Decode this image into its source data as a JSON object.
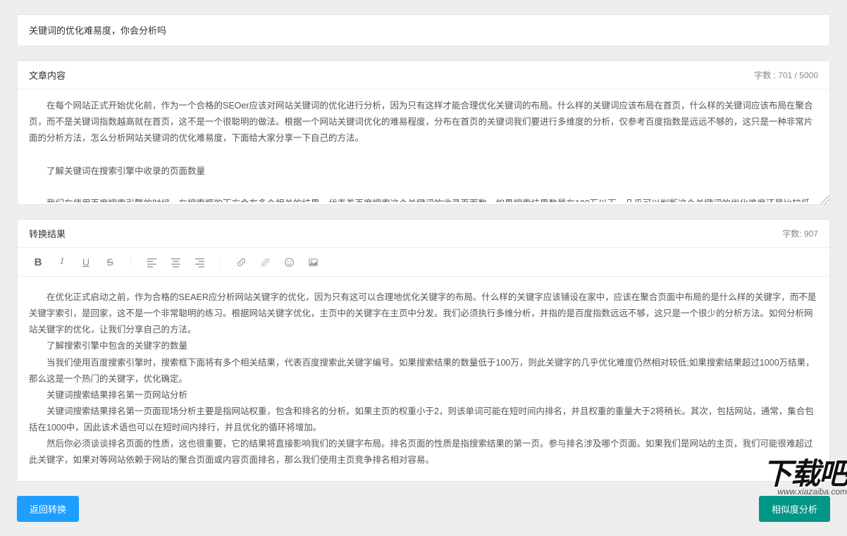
{
  "title_input": {
    "value": "关键词的优化难易度，你会分析吗"
  },
  "content_section": {
    "label": "文章内容",
    "count_label": "字数 : 701 / 5000",
    "textarea_value": "　　在每个网站正式开始优化前，作为一个合格的SEOer应该对网站关键词的优化进行分析，因为只有这样才能合理优化关键词的布局。什么样的关键词应该布局在首页，什么样的关键词应该布局在聚合页，而不是关键词指数越高就在首页，这不是一个很聪明的做法。根据一个网站关键词优化的难易程度，分布在首页的关键词我们要进行多维度的分析，仅参考百度指数是远远不够的，这只是一种非常片面的分析方法，怎么分析网站关键词的优化难易度，下面给大家分享一下自己的方法。\n\n　　了解关键词在搜索引擎中收录的页面数量\n\n　　我们在使用百度搜索引擎的时候，在搜索框的下方会有多个相关的结果，代表着百度搜索这个关键词的收录页面数。如果搜索结果数量在100万以下，几乎可以判断这个关键词的优化难度还是比较低的；如果搜索结果在1000万以上的结果，那么这是一个热门关键词，优化是有一定难度的。\n\n　　关键词搜索结果排名第一页网站分析"
  },
  "result_section": {
    "label": "转换结果",
    "count_label": "字数: 907",
    "paragraphs": [
      "在优化正式启动之前，作为合格的SEAER应分析网站关键字的优化，因为只有这可以合理地优化关键字的布局。什么样的关键字应该铺设在家中，应该在聚合页面中布局的是什么样的关键字，而不是关键字索引，是回家，这不是一个非常聪明的练习。根据网站关键字优化，主页中的关键字在主页中分发。我们必须执行多维分析，并指的是百度指数远远不够，这只是一个很少的分析方法。如何分析网站关键字的优化，让我们分享自己的方法。",
      "了解搜索引擎中包含的关键字的数量",
      "当我们使用百度搜索引擎时，搜索框下面将有多个相关结果，代表百度搜索此关键字编号。如果搜索结果的数量低于100万，则此关键字的几乎优化难度仍然相对较低;如果搜索结果超过1000万结果，那么这是一个热门的关键字，优化确定。",
      "关键词搜索结果排名第一页网站分析",
      "关键词搜索结果排名第一页面现场分析主要是指网站权重，包含和排名的分析。如果主页的权重小于2，则该单词可能在短时间内排名，并且权重的重量大于2将稍长。其次，包括网站，通常，集合包括在1000中，因此该术语也可以在短时间内排行，并且优化的循环将增加。",
      "然后你必须谈谈排名页面的性质，这也很重要，它的结果将直接影响我们的关键字布局。排名页面的性质是指搜索结果的第一页。参与排名涉及哪个页面。如果我们是网站的主页，我们可能很难超过此关键字，如果对等网站依赖于网站的聚合页面或内容页面排名，那么我们使用主页竞争排名相对容易。"
    ]
  },
  "buttons": {
    "back": "返回转换",
    "similarity": "相似度分析"
  },
  "toolbar": {
    "bold": "B",
    "italic": "I",
    "underline": "U",
    "strike": "S"
  },
  "watermark": {
    "big": "下载吧",
    "small": "www.xiazaiba.com"
  }
}
